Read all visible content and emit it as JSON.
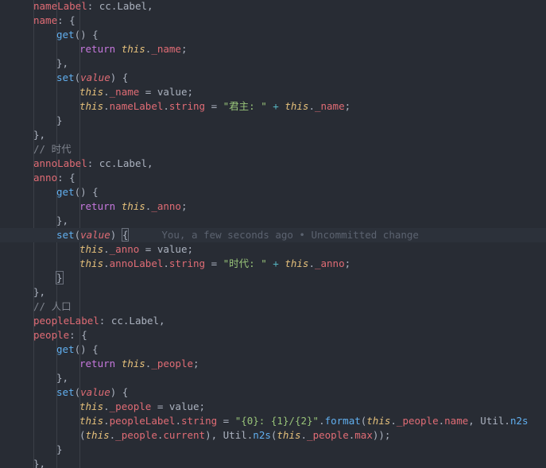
{
  "editor": {
    "blame_text": "You, a few seconds ago • Uncommitted change",
    "lines": [
      {
        "indent": 2,
        "tokens": [
          [
            "nameLabel",
            "prop"
          ],
          [
            ": cc.Label,",
            "plain"
          ]
        ]
      },
      {
        "indent": 2,
        "tokens": [
          [
            "name",
            "prop"
          ],
          [
            ": {",
            "plain"
          ]
        ]
      },
      {
        "indent": 3,
        "tokens": [
          [
            "get",
            "fn"
          ],
          [
            "() {",
            "plain"
          ]
        ]
      },
      {
        "indent": 4,
        "tokens": [
          [
            "return ",
            "kw"
          ],
          [
            "this",
            "this"
          ],
          [
            ".",
            "plain"
          ],
          [
            "_name",
            "prop"
          ],
          [
            ";",
            "plain"
          ]
        ]
      },
      {
        "indent": 3,
        "tokens": [
          [
            "},",
            "plain"
          ]
        ]
      },
      {
        "indent": 3,
        "tokens": [
          [
            "set",
            "fn"
          ],
          [
            "(",
            "plain"
          ],
          [
            "value",
            "param"
          ],
          [
            ") {",
            "plain"
          ]
        ]
      },
      {
        "indent": 4,
        "tokens": [
          [
            "this",
            "this"
          ],
          [
            ".",
            "plain"
          ],
          [
            "_name",
            "prop"
          ],
          [
            " = value;",
            "plain"
          ]
        ]
      },
      {
        "indent": 4,
        "tokens": [
          [
            "this",
            "this"
          ],
          [
            ".",
            "plain"
          ],
          [
            "nameLabel",
            "prop"
          ],
          [
            ".",
            "plain"
          ],
          [
            "string",
            "prop"
          ],
          [
            " = ",
            "plain"
          ],
          [
            "\"君主: \"",
            "str"
          ],
          [
            " + ",
            "op"
          ],
          [
            "this",
            "this"
          ],
          [
            ".",
            "plain"
          ],
          [
            "_name",
            "prop"
          ],
          [
            ";",
            "plain"
          ]
        ]
      },
      {
        "indent": 3,
        "tokens": [
          [
            "}",
            "plain"
          ]
        ]
      },
      {
        "indent": 2,
        "tokens": [
          [
            "},",
            "plain"
          ]
        ]
      },
      {
        "indent": 2,
        "tokens": [
          [
            "// 时代",
            "cmt"
          ]
        ]
      },
      {
        "indent": 2,
        "tokens": [
          [
            "annoLabel",
            "prop"
          ],
          [
            ": cc.Label,",
            "plain"
          ]
        ]
      },
      {
        "indent": 2,
        "tokens": [
          [
            "anno",
            "prop"
          ],
          [
            ": {",
            "plain"
          ]
        ]
      },
      {
        "indent": 3,
        "tokens": [
          [
            "get",
            "fn"
          ],
          [
            "() {",
            "plain"
          ]
        ]
      },
      {
        "indent": 4,
        "tokens": [
          [
            "return ",
            "kw"
          ],
          [
            "this",
            "this"
          ],
          [
            ".",
            "plain"
          ],
          [
            "_anno",
            "prop"
          ],
          [
            ";",
            "plain"
          ]
        ]
      },
      {
        "indent": 3,
        "tokens": [
          [
            "},",
            "plain"
          ]
        ]
      },
      {
        "indent": 3,
        "current": true,
        "blame": true,
        "tokens": [
          [
            "set",
            "fn"
          ],
          [
            "(",
            "plain"
          ],
          [
            "value",
            "param"
          ],
          [
            ") ",
            "plain"
          ],
          [
            "{",
            "brk"
          ]
        ]
      },
      {
        "indent": 4,
        "tokens": [
          [
            "this",
            "this"
          ],
          [
            ".",
            "plain"
          ],
          [
            "_anno",
            "prop"
          ],
          [
            " = value;",
            "plain"
          ]
        ]
      },
      {
        "indent": 4,
        "tokens": [
          [
            "this",
            "this"
          ],
          [
            ".",
            "plain"
          ],
          [
            "annoLabel",
            "prop"
          ],
          [
            ".",
            "plain"
          ],
          [
            "string",
            "prop"
          ],
          [
            " = ",
            "plain"
          ],
          [
            "\"时代: \"",
            "str"
          ],
          [
            " + ",
            "op"
          ],
          [
            "this",
            "this"
          ],
          [
            ".",
            "plain"
          ],
          [
            "_anno",
            "prop"
          ],
          [
            ";",
            "plain"
          ]
        ]
      },
      {
        "indent": 3,
        "tokens": [
          [
            "}",
            "brk"
          ]
        ]
      },
      {
        "indent": 2,
        "tokens": [
          [
            "},",
            "plain"
          ]
        ]
      },
      {
        "indent": 2,
        "tokens": [
          [
            "// 人口",
            "cmt"
          ]
        ]
      },
      {
        "indent": 2,
        "tokens": [
          [
            "peopleLabel",
            "prop"
          ],
          [
            ": cc.Label,",
            "plain"
          ]
        ]
      },
      {
        "indent": 2,
        "tokens": [
          [
            "people",
            "prop"
          ],
          [
            ": {",
            "plain"
          ]
        ]
      },
      {
        "indent": 3,
        "tokens": [
          [
            "get",
            "fn"
          ],
          [
            "() {",
            "plain"
          ]
        ]
      },
      {
        "indent": 4,
        "tokens": [
          [
            "return ",
            "kw"
          ],
          [
            "this",
            "this"
          ],
          [
            ".",
            "plain"
          ],
          [
            "_people",
            "prop"
          ],
          [
            ";",
            "plain"
          ]
        ]
      },
      {
        "indent": 3,
        "tokens": [
          [
            "},",
            "plain"
          ]
        ]
      },
      {
        "indent": 3,
        "tokens": [
          [
            "set",
            "fn"
          ],
          [
            "(",
            "plain"
          ],
          [
            "value",
            "param"
          ],
          [
            ") {",
            "plain"
          ]
        ]
      },
      {
        "indent": 4,
        "tokens": [
          [
            "this",
            "this"
          ],
          [
            ".",
            "plain"
          ],
          [
            "_people",
            "prop"
          ],
          [
            " = value;",
            "plain"
          ]
        ]
      },
      {
        "indent": 4,
        "tokens": [
          [
            "this",
            "this"
          ],
          [
            ".",
            "plain"
          ],
          [
            "peopleLabel",
            "prop"
          ],
          [
            ".",
            "plain"
          ],
          [
            "string",
            "prop"
          ],
          [
            " = ",
            "plain"
          ],
          [
            "\"{0}: {1}/{2}\"",
            "str"
          ],
          [
            ".",
            "plain"
          ],
          [
            "format",
            "fn"
          ],
          [
            "(",
            "plain"
          ],
          [
            "this",
            "this"
          ],
          [
            ".",
            "plain"
          ],
          [
            "_people",
            "prop"
          ],
          [
            ".",
            "plain"
          ],
          [
            "name",
            "prop"
          ],
          [
            ", Util.",
            "plain"
          ],
          [
            "n2s",
            "fn"
          ]
        ]
      },
      {
        "indent": 4,
        "tokens": [
          [
            "(",
            "plain"
          ],
          [
            "this",
            "this"
          ],
          [
            ".",
            "plain"
          ],
          [
            "_people",
            "prop"
          ],
          [
            ".",
            "plain"
          ],
          [
            "current",
            "prop"
          ],
          [
            "), Util.",
            "plain"
          ],
          [
            "n2s",
            "fn"
          ],
          [
            "(",
            "plain"
          ],
          [
            "this",
            "this"
          ],
          [
            ".",
            "plain"
          ],
          [
            "_people",
            "prop"
          ],
          [
            ".",
            "plain"
          ],
          [
            "max",
            "prop"
          ],
          [
            "));",
            "plain"
          ]
        ]
      },
      {
        "indent": 3,
        "tokens": [
          [
            "}",
            "plain"
          ]
        ]
      },
      {
        "indent": 2,
        "tokens": [
          [
            "},",
            "plain"
          ]
        ]
      }
    ]
  }
}
